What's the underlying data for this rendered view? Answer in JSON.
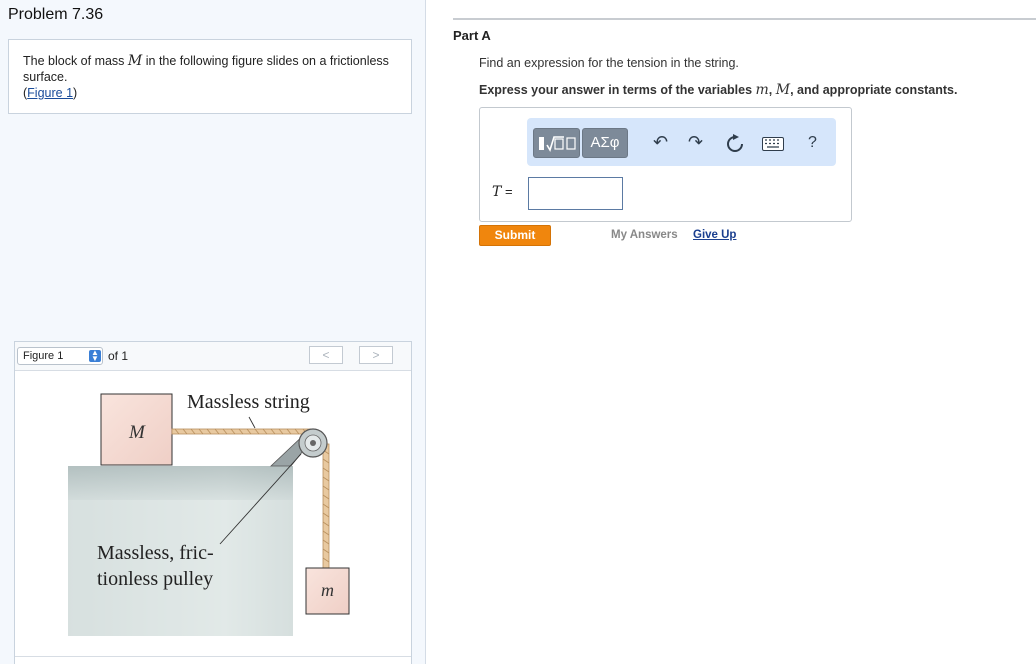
{
  "problem": {
    "title": "Problem 7.36",
    "text_before_var": "The block of mass",
    "var_M": "M",
    "text_after_var": "in the following figure slides on a frictionless surface.",
    "figure_link_open": "(",
    "figure_link": "Figure 1",
    "figure_link_close": ")"
  },
  "figure": {
    "selector_value": "Figure 1",
    "of_text": "of 1",
    "prev_glyph": "<",
    "next_glyph": ">",
    "labels": {
      "string": "Massless string",
      "pulley_line1": "Massless, fric-",
      "pulley_line2": "tionless pulley",
      "block_M": "M",
      "block_m": "m"
    }
  },
  "part": {
    "title": "Part A",
    "question": "Find an expression for the tension in the string.",
    "instruction_prefix": "Express your answer in terms of the variables",
    "var_m": "m",
    "sep1": ", ",
    "var_M": "M",
    "instruction_suffix": ", and appropriate constants."
  },
  "editor": {
    "greek_label": "ΑΣφ",
    "help_label": "?",
    "variable_label": "T =",
    "answer_value": "",
    "icons": [
      "templates-icon",
      "greek-letters-icon",
      "undo-icon",
      "redo-icon",
      "reset-icon",
      "keyboard-icon",
      "help-icon"
    ]
  },
  "actions": {
    "submit": "Submit",
    "my_answers": "My Answers",
    "give_up": "Give Up"
  },
  "colors": {
    "submit_orange": "#f0860d",
    "toolbar_blue": "#d6e6fb",
    "link_blue": "#1a4c9a"
  }
}
